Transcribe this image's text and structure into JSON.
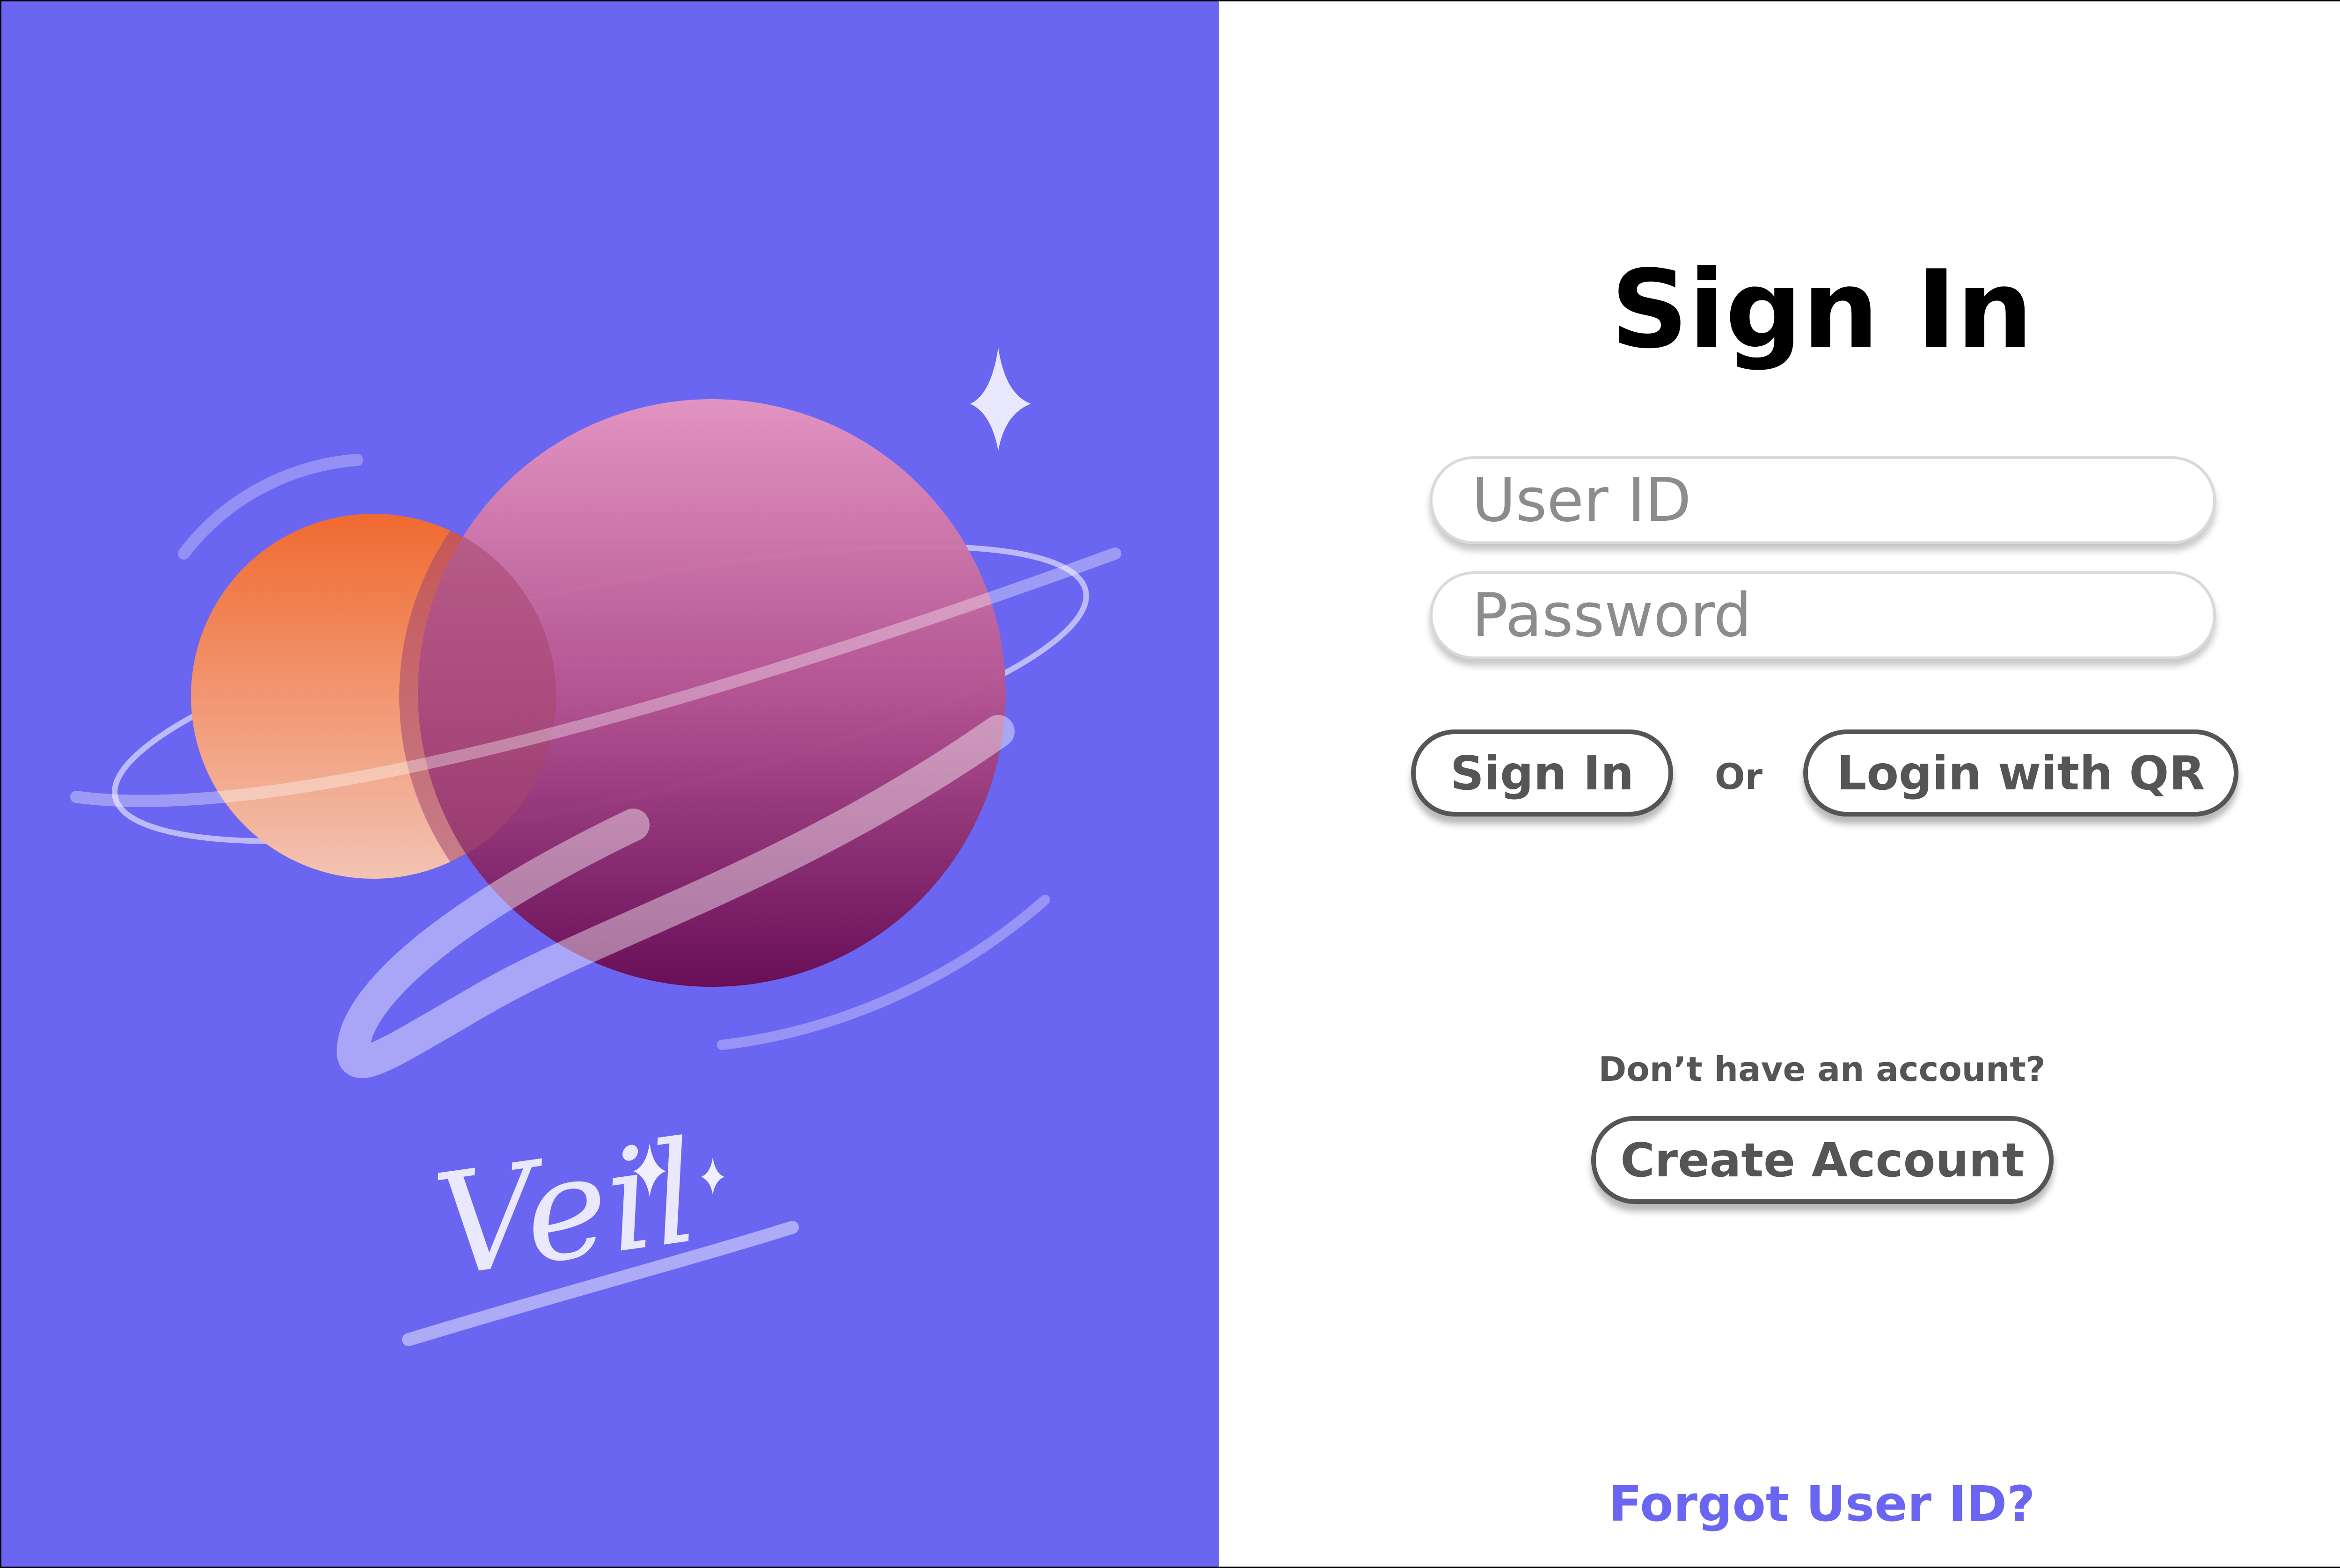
{
  "brand": {
    "logo_text": "Veil"
  },
  "colors": {
    "hero_background": "#6b66f2",
    "accent": "#6b66f2",
    "button_text": "#555555",
    "title": "#000000"
  },
  "form": {
    "title": "Sign In",
    "userid_placeholder": "User ID",
    "password_placeholder": "Password",
    "signin_label": "Sign In",
    "or_label": "Or",
    "qr_label": "Login with QR"
  },
  "signup": {
    "prompt": "Don’t have an account?",
    "create_label": "Create Account"
  },
  "footer": {
    "forgot_label": "Forgot User ID?"
  }
}
